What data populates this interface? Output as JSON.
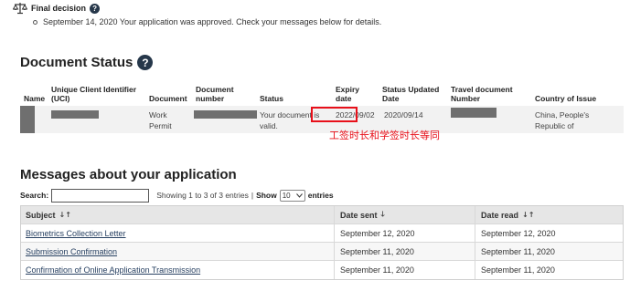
{
  "final_decision": {
    "title": "Final decision",
    "help": "?",
    "text": "September 14, 2020 Your application was approved. Check your messages below for details."
  },
  "document_status": {
    "title": "Document Status",
    "help": "?",
    "headers": {
      "name": "Name",
      "uci_line1": "Unique Client Identifier",
      "uci_line2": "(UCI)",
      "document": "Document",
      "number_line1": "Document",
      "number_line2": "number",
      "status": "Status",
      "expiry_line1": "Expiry",
      "expiry_line2": "date",
      "updated_line1": "Status Updated",
      "updated_line2": "Date",
      "travel_line1": "Travel document",
      "travel_line2": "Number",
      "country": "Country of Issue"
    },
    "row": {
      "document_line1": "Work",
      "document_line2": "Permit",
      "status_line1": "Your document is",
      "status_line2": "valid.",
      "expiry": "2022/09/02",
      "updated": "2020/09/14",
      "country_line1": "China, People's",
      "country_line2": "Republic of"
    }
  },
  "annotation": "工签时长和学签时长等同",
  "messages": {
    "title": "Messages about your application",
    "search_label": "Search:",
    "search_value": "",
    "info": "Showing 1 to 3 of 3 entries",
    "separator": "|",
    "show_label": "Show",
    "show_value": "10",
    "entries_label": "entries",
    "columns": [
      "Subject",
      "Date sent",
      "Date read"
    ],
    "rows": [
      {
        "subject": "Biometrics Collection Letter",
        "sent": "September 12, 2020",
        "read": "September 12, 2020"
      },
      {
        "subject": "Submission Confirmation",
        "sent": "September 11, 2020",
        "read": "September 11, 2020"
      },
      {
        "subject": "Confirmation of Online Application Transmission",
        "sent": "September 11, 2020",
        "read": "September 11, 2020"
      }
    ]
  },
  "colors": {
    "accent": "#26374a",
    "link": "#284162",
    "highlight": "#e8101a",
    "redaction": "#6f6f6f"
  }
}
